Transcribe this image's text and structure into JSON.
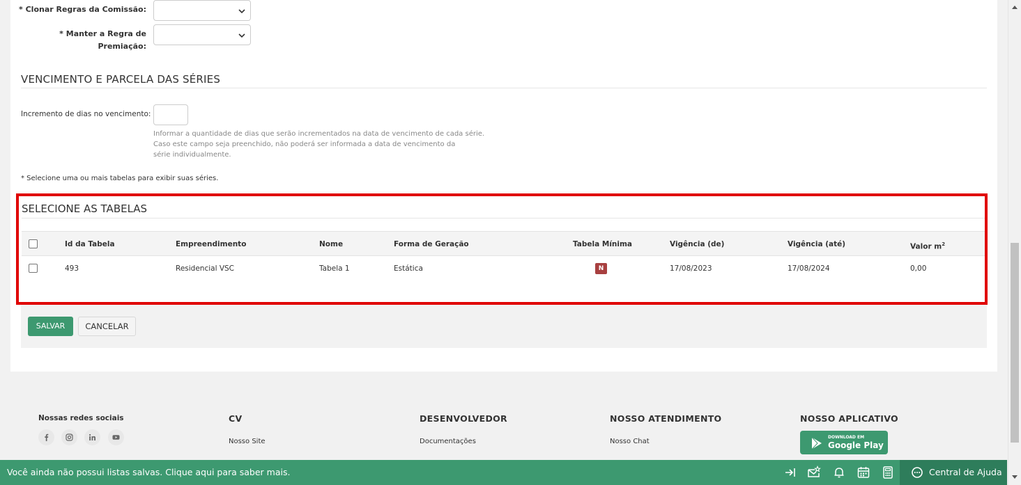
{
  "form": {
    "clone_rules_label": "* Clonar Regras da Comissão:",
    "keep_rule_label_line1": "* Manter a Regra de",
    "keep_rule_label_line2": "Premiação:"
  },
  "due_section": {
    "title": "VENCIMENTO E PARCELA DAS SÉRIES",
    "increment_label": "Incremento de dias no vencimento:",
    "increment_value": "",
    "help_line1": "Informar a quantidade de dias que serão incrementados na data de vencimento de cada série.",
    "help_line2": "Caso este campo seja preenchido, não poderá ser informada a data de vencimento da",
    "help_line3": "série individualmente.",
    "note": "* Selecione uma ou mais tabelas para exibir suas séries."
  },
  "tables": {
    "title": "SELECIONE AS TABELAS",
    "headers": {
      "id": "Id da Tabela",
      "development": "Empreendimento",
      "name": "Nome",
      "generation": "Forma de Geração",
      "min_table": "Tabela Mínima",
      "valid_from": "Vigência (de)",
      "valid_to": "Vigência (até)",
      "value_m2": "Valor m",
      "value_m2_sup": "2"
    },
    "rows": [
      {
        "id": "493",
        "development": "Residencial VSC",
        "name": "Tabela 1",
        "generation": "Estática",
        "min_table": "N",
        "valid_from": "17/08/2023",
        "valid_to": "17/08/2024",
        "value_m2": "0,00"
      }
    ]
  },
  "actions": {
    "save": "SALVAR",
    "cancel": "CANCELAR"
  },
  "footer": {
    "social_title": "Nossas redes sociais",
    "social_icons": [
      "facebook-icon",
      "instagram-icon",
      "linkedin-icon",
      "youtube-icon"
    ],
    "cv_title": "CV",
    "cv_link": "Nosso Site",
    "dev_title": "DESENVOLVEDOR",
    "dev_link": "Documentações",
    "support_title": "NOSSO ATENDIMENTO",
    "support_link": "Nosso Chat",
    "app_title": "NOSSO APLICATIVO",
    "gplay_small": "DOWNLOAD EM",
    "gplay_big": "Google Play"
  },
  "bottom_bar": {
    "message": "Você ainda não possui listas salvas. Clique aqui para saber mais.",
    "help": "Central de Ajuda",
    "icons": [
      "collapse-arrow-icon",
      "mail-star-icon",
      "bell-icon",
      "calendar-icon",
      "calculator-icon",
      "chat-help-icon"
    ]
  },
  "colors": {
    "primary_green": "#3d9970",
    "dark_green": "#2e7d5b",
    "highlight_red": "#e00000",
    "badge_red": "#a84040"
  }
}
